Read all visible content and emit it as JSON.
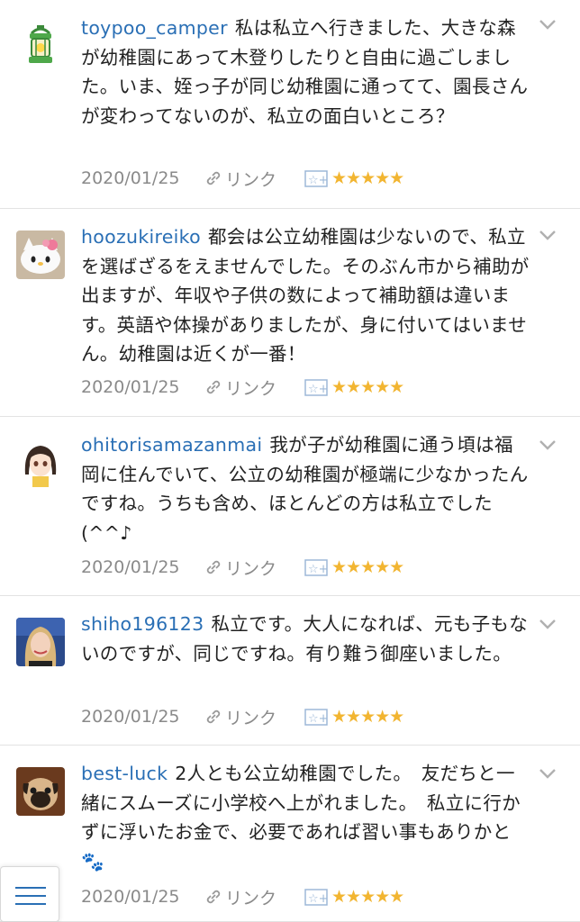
{
  "comments": [
    {
      "username": "toypoo_camper",
      "text": "私は私立へ行きました、大きな森が幼稚園にあって木登りしたりと自由に過ごしました。いま、姪っ子が同じ幼稚園に通ってて、園長さんが変わってないのが、私立の面白いところ？",
      "date": "2020/01/25",
      "link_label": "リンク",
      "stars": "★★★★★",
      "avatar_icon": "lantern-avatar-icon"
    },
    {
      "username": "hoozukireiko",
      "text": "都会は公立幼稚園は少ないので、私立を選ばざるをえませんでした。そのぶん市から補助が出ますが、年収や子供の数によって補助額は違います。英語や体操がありましたが、身に付いてはいません。幼稚園は近くが一番！",
      "date": "2020/01/25",
      "link_label": "リンク",
      "stars": "★★★★★",
      "avatar_icon": "kitty-avatar-icon"
    },
    {
      "username": "ohitorisamazanmai",
      "text": "我が子が幼稚園に通う頃は福岡に住んでいて、公立の幼稚園が極端に少なかったんですね。うちも含め、ほとんどの方は私立でした(^^♪",
      "date": "2020/01/25",
      "link_label": "リンク",
      "stars": "★★★★★",
      "avatar_icon": "girl-avatar-icon"
    },
    {
      "username": "shiho196123",
      "text": "私立です。大人になれば、元も子もないのですが、同じですね。有り難う御座いました。",
      "date": "2020/01/25",
      "link_label": "リンク",
      "stars": "★★★★★",
      "avatar_icon": "woman-photo-avatar-icon"
    },
    {
      "username": "best-luck",
      "text": "2人とも公立幼稚園でした。　友だちと一緒にスムーズに小学校へ上がれました。　私立に行かずに浮いたお金で、必要であれば習い事もありかと🐾",
      "date": "2020/01/25",
      "link_label": "リンク",
      "stars": "★★★★★",
      "avatar_icon": "pug-avatar-icon"
    }
  ],
  "menu_icon": "hamburger-menu-icon",
  "colors": {
    "username": "#2a6fb5",
    "meta": "#8a8a8a",
    "stars": "#f2b531",
    "divider": "#e3e3e3"
  }
}
